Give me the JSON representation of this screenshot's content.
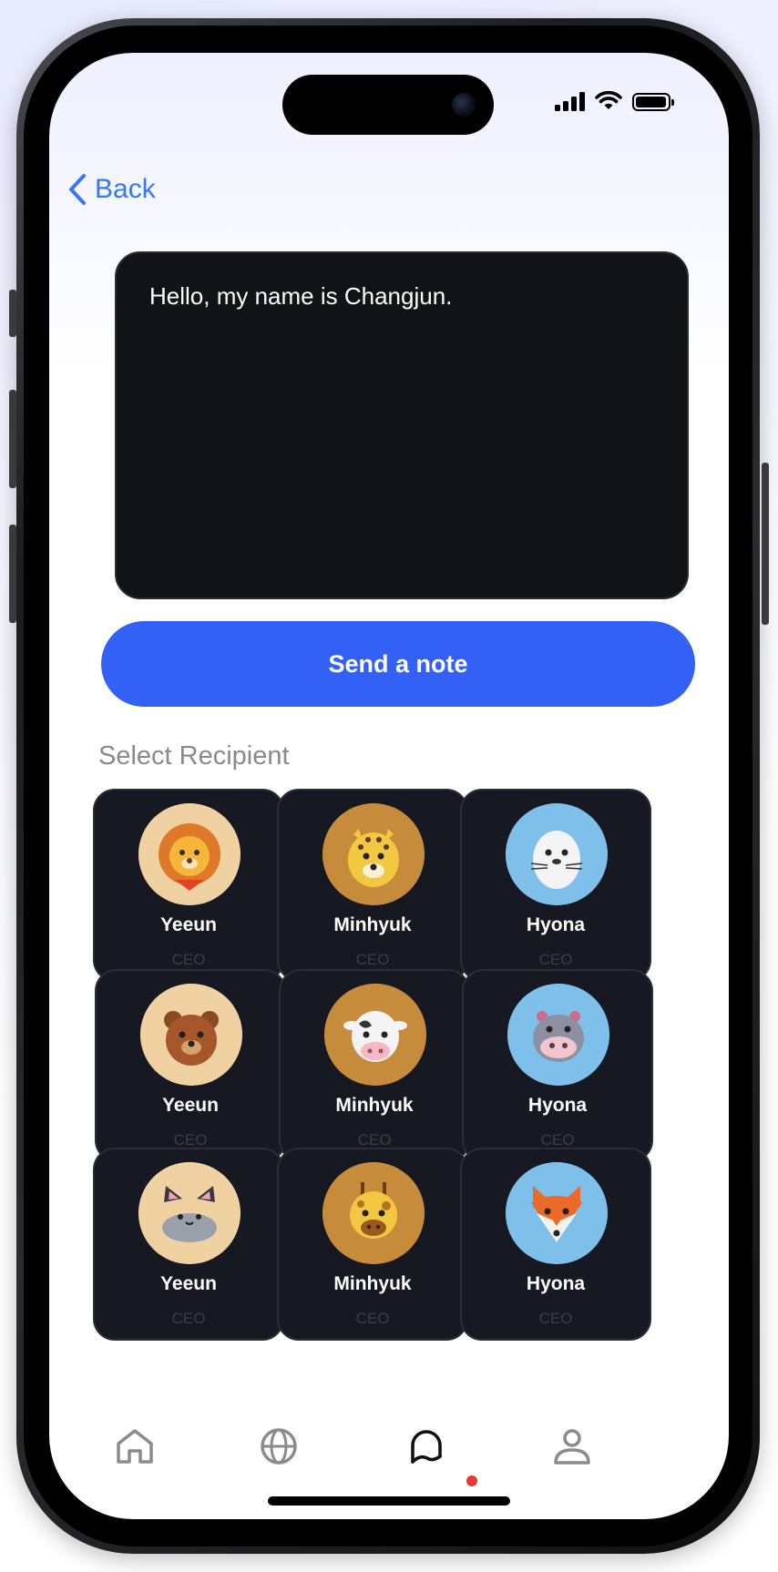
{
  "header": {
    "back_label": "Back"
  },
  "note": {
    "text": "Hello, my name is Changjun."
  },
  "actions": {
    "send_label": "Send a note"
  },
  "recipients": {
    "title": "Select Recipient",
    "items": [
      {
        "name": "Yeeun",
        "role": "CEO",
        "icon": "lion-icon",
        "bg": "#f0d2a2"
      },
      {
        "name": "Minhyuk",
        "role": "CEO",
        "icon": "leopard-icon",
        "bg": "#c68c3b"
      },
      {
        "name": "Hyona",
        "role": "CEO",
        "icon": "seal-icon",
        "bg": "#7ec0ea"
      },
      {
        "name": "Yeeun",
        "role": "CEO",
        "icon": "bear-icon",
        "bg": "#f0d2a2"
      },
      {
        "name": "Minhyuk",
        "role": "CEO",
        "icon": "cow-icon",
        "bg": "#c68c3b"
      },
      {
        "name": "Hyona",
        "role": "CEO",
        "icon": "hippo-icon",
        "bg": "#7ec0ea"
      },
      {
        "name": "Yeeun",
        "role": "CEO",
        "icon": "cat-icon",
        "bg": "#f0d2a2"
      },
      {
        "name": "Minhyuk",
        "role": "CEO",
        "icon": "giraffe-icon",
        "bg": "#c68c3b"
      },
      {
        "name": "Hyona",
        "role": "CEO",
        "icon": "fox-icon",
        "bg": "#7ec0ea"
      }
    ]
  },
  "nav": {
    "items": [
      "home-icon",
      "globe-icon",
      "chat-icon",
      "profile-icon"
    ],
    "active": "chat-icon"
  },
  "colors": {
    "accent": "#3461f5",
    "link": "#3677f6",
    "card": "#161922",
    "notification_dot": "#e53935"
  }
}
